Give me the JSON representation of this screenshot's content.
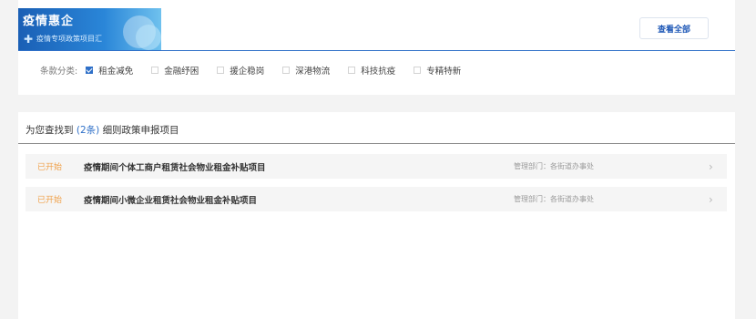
{
  "banner": {
    "title": "疫情惠企",
    "subtitle": "疫情专项政策项目汇"
  },
  "header": {
    "view_all_label": "查看全部"
  },
  "filters": {
    "label": "条款分类:",
    "options": [
      {
        "label": "租金减免",
        "checked": true
      },
      {
        "label": "金融纾困",
        "checked": false
      },
      {
        "label": "援企稳岗",
        "checked": false
      },
      {
        "label": "深港物流",
        "checked": false
      },
      {
        "label": "科技抗疫",
        "checked": false
      },
      {
        "label": "专精特新",
        "checked": false
      }
    ]
  },
  "results": {
    "prefix": "为您查找到",
    "count": "(2条)",
    "suffix": "细则政策申报项目",
    "items": [
      {
        "status": "已开始",
        "title": "疫情期间个体工商户租赁社会物业租金补贴项目",
        "dept": "管理部门：各街道办事处"
      },
      {
        "status": "已开始",
        "title": "疫情期间小微企业租赁社会物业租金补贴项目",
        "dept": "管理部门：各街道办事处"
      }
    ]
  },
  "colors": {
    "accent": "#2f70c8",
    "status": "#f0a14a",
    "page_bg": "#f3f3f3"
  }
}
